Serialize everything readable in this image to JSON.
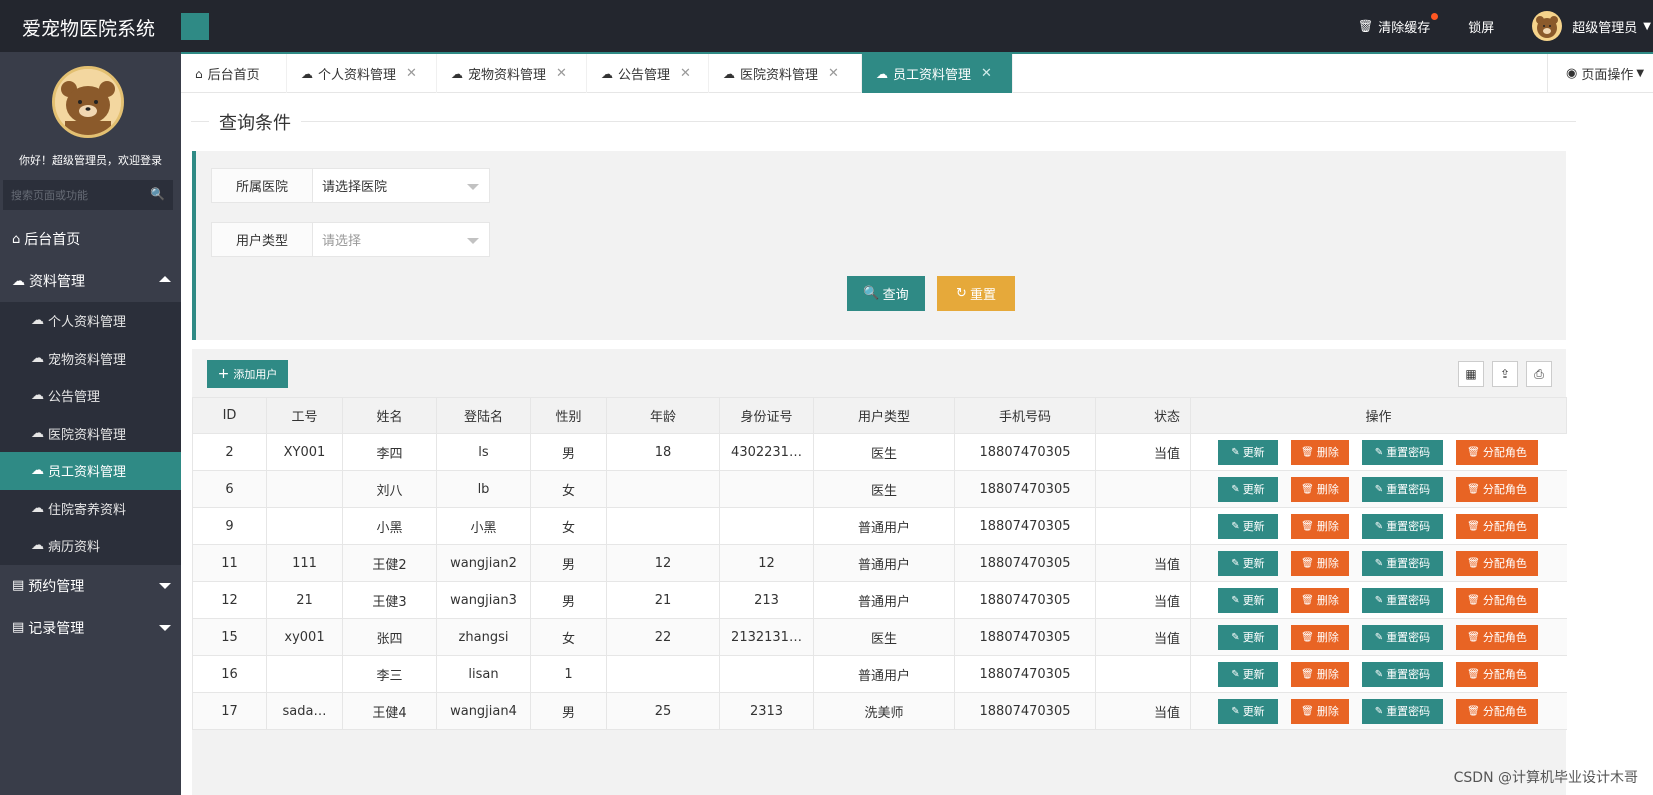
{
  "app": {
    "title": "爱宠物医院系统"
  },
  "topbar": {
    "clear_cache": "清除缓存",
    "lock": "锁屏",
    "user": "超级管理员"
  },
  "sidebar": {
    "welcome": "你好！超级管理员，欢迎登录",
    "search_placeholder": "搜索页面或功能",
    "items": [
      {
        "label": "后台首页",
        "icon": "home-icon"
      },
      {
        "label": "资料管理",
        "icon": "cloud-icon",
        "expanded": true,
        "children": [
          {
            "label": "个人资料管理"
          },
          {
            "label": "宠物资料管理"
          },
          {
            "label": "公告管理"
          },
          {
            "label": "医院资料管理"
          },
          {
            "label": "员工资料管理",
            "active": true
          },
          {
            "label": "住院寄养资料"
          },
          {
            "label": "病历资料"
          }
        ]
      },
      {
        "label": "预约管理",
        "icon": "clipboard-icon"
      },
      {
        "label": "记录管理",
        "icon": "clipboard-icon"
      }
    ]
  },
  "tabs": {
    "items": [
      {
        "label": "后台首页",
        "closable": false
      },
      {
        "label": "个人资料管理",
        "closable": true
      },
      {
        "label": "宠物资料管理",
        "closable": true
      },
      {
        "label": "公告管理",
        "closable": true
      },
      {
        "label": "医院资料管理",
        "closable": true
      },
      {
        "label": "员工资料管理",
        "closable": true,
        "active": true
      }
    ],
    "page_ops": "页面操作"
  },
  "query": {
    "title": "查询条件",
    "hospital_label": "所属医院",
    "hospital_value": "请选择医院",
    "user_type_label": "用户类型",
    "user_type_placeholder": "请选择",
    "search_button": "查询",
    "reset_button": "重置"
  },
  "table": {
    "add_button": "添加用户",
    "columns": [
      "ID",
      "工号",
      "姓名",
      "登陆名",
      "性别",
      "年龄",
      "身份证号",
      "用户类型",
      "手机号码",
      "状态",
      "操作"
    ],
    "actions": {
      "update": "更新",
      "delete": "删除",
      "reset_password": "重置密码",
      "assign_role": "分配角色"
    },
    "rows": [
      [
        "2",
        "XY001",
        "李四",
        "ls",
        "男",
        "18",
        "4302231…",
        "医生",
        "18807470305",
        "当值"
      ],
      [
        "6",
        "",
        "刘八",
        "lb",
        "女",
        "",
        "",
        "医生",
        "18807470305",
        ""
      ],
      [
        "9",
        "",
        "小黑",
        "小黑",
        "女",
        "",
        "",
        "普通用户",
        "18807470305",
        ""
      ],
      [
        "11",
        "111",
        "王健2",
        "wangjian2",
        "男",
        "12",
        "12",
        "普通用户",
        "18807470305",
        "当值"
      ],
      [
        "12",
        "21",
        "王健3",
        "wangjian3",
        "男",
        "21",
        "213",
        "普通用户",
        "18807470305",
        "当值"
      ],
      [
        "15",
        "xy001",
        "张四",
        "zhangsi",
        "女",
        "22",
        "2132131…",
        "医生",
        "18807470305",
        "当值"
      ],
      [
        "16",
        "",
        "李三",
        "lisan",
        "1",
        "",
        "",
        "普通用户",
        "18807470305",
        ""
      ],
      [
        "17",
        "sada…",
        "王健4",
        "wangjian4",
        "男",
        "25",
        "2313",
        "洗美师",
        "18807470305",
        "当值"
      ]
    ]
  },
  "watermark": "CSDN @计算机毕业设计木哥",
  "colors": {
    "primary": "#2f8a85",
    "warning": "#e6a93a",
    "danger": "#e86424",
    "sidebar": "#393d49",
    "topbar": "#23262e"
  }
}
